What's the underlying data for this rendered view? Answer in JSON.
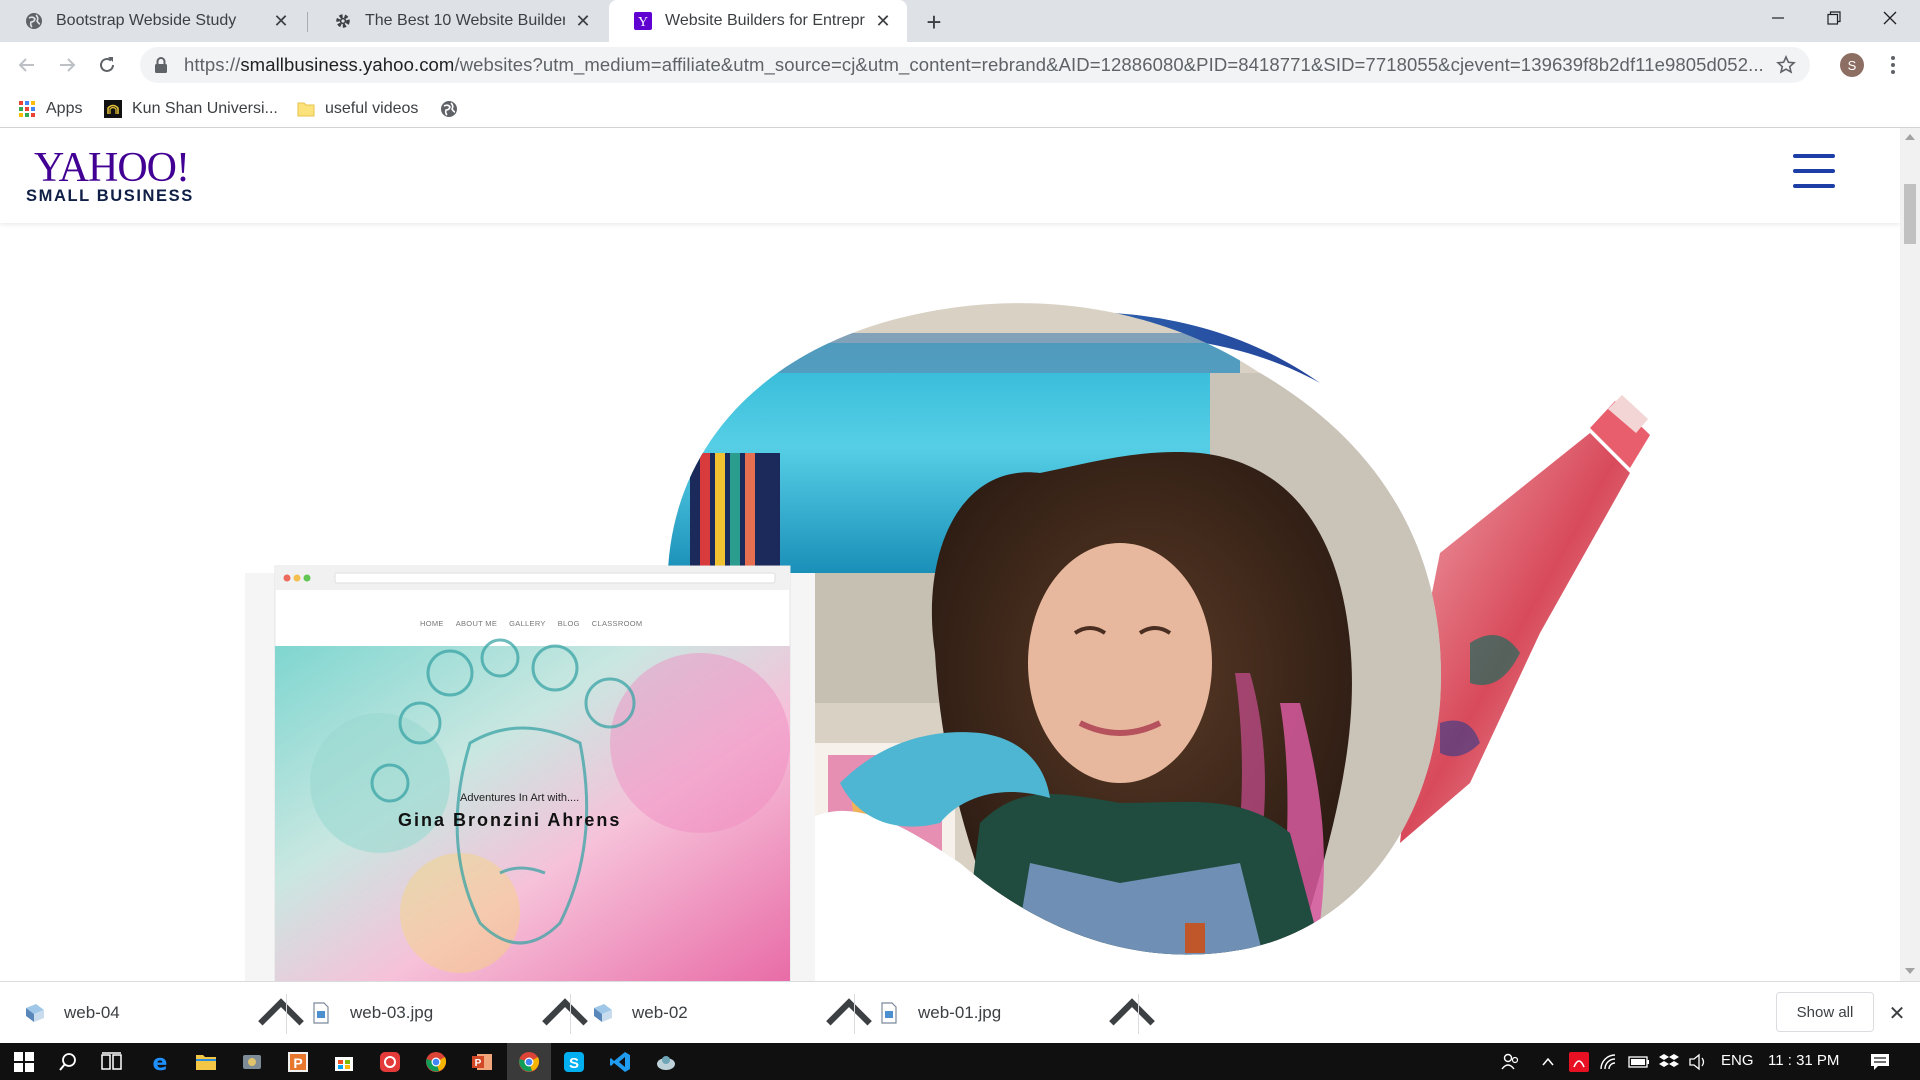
{
  "browser": {
    "tabs": [
      {
        "title": "Bootstrap Webside Study",
        "icon": "globe-icon",
        "active": false
      },
      {
        "title": "The Best 10 Website Builders -",
        "icon": "gear-icon",
        "active": false
      },
      {
        "title": "Website Builders for Entrepren",
        "icon": "yahoo-favicon-icon",
        "active": true
      }
    ],
    "url_scheme": "https://",
    "url_host": "smallbusiness.yahoo.com",
    "url_rest": "/websites?utm_medium=affiliate&utm_source=cj&utm_content=rebrand&AID=12886080&PID=8418771&SID=7718055&cjevent=139639f8b2df11e9805d052...",
    "profile_initial": "S",
    "bookmarks": [
      {
        "label": "Apps",
        "icon": "apps-grid-icon"
      },
      {
        "label": "Kun Shan Universi...",
        "icon": "university-logo-icon"
      },
      {
        "label": "useful videos",
        "icon": "folder-icon"
      },
      {
        "label": "",
        "icon": "globe-icon"
      }
    ]
  },
  "site": {
    "logo_main": "YAHOO!",
    "logo_sub": "SMALL BUSINESS",
    "mockup": {
      "nav": [
        "HOME",
        "ABOUT ME",
        "GALLERY",
        "BLOG",
        "CLASSROOM"
      ],
      "tagline": "Adventures In Art with....",
      "name": "Gina Bronzini Ahrens"
    }
  },
  "downloads": {
    "items": [
      {
        "name": "web-04",
        "icon": "image-file-icon"
      },
      {
        "name": "web-03.jpg",
        "icon": "jpg-file-icon"
      },
      {
        "name": "web-02",
        "icon": "image-file-icon"
      },
      {
        "name": "web-01.jpg",
        "icon": "jpg-file-icon"
      }
    ],
    "show_all": "Show all"
  },
  "taskbar": {
    "language": "ENG",
    "time": "11 : 31 PM"
  },
  "colors": {
    "yahoo_purple": "#410093",
    "hamburger_blue": "#1d3ea6",
    "tab_strip": "#dee1e6",
    "taskbar": "#101010"
  }
}
